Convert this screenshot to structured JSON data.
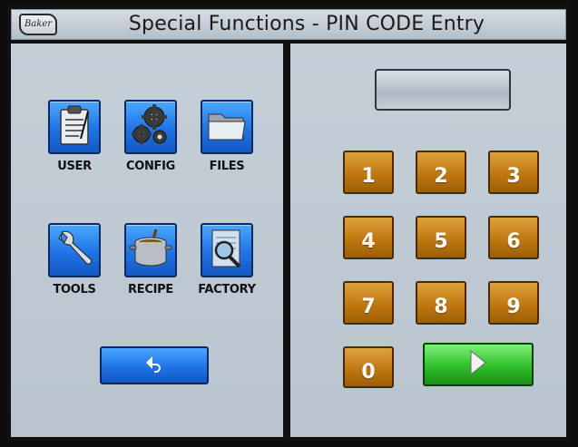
{
  "window": {
    "title": "Special Functions - PIN CODE Entry",
    "logo_text": "Baker"
  },
  "menu": {
    "items": [
      {
        "label": "USER",
        "icon": "clipboard-icon"
      },
      {
        "label": "CONFIG",
        "icon": "gears-icon"
      },
      {
        "label": "FILES",
        "icon": "folder-icon"
      },
      {
        "label": "TOOLS",
        "icon": "wrench-icon"
      },
      {
        "label": "RECIPE",
        "icon": "pot-icon"
      },
      {
        "label": "FACTORY",
        "icon": "magnifier-icon"
      }
    ],
    "back_icon": "back-arrow-icon"
  },
  "pin": {
    "display_value": ""
  },
  "keypad": {
    "keys": [
      "1",
      "2",
      "3",
      "4",
      "5",
      "6",
      "7",
      "8",
      "9",
      "0"
    ],
    "enter_icon": "play-arrow-icon"
  },
  "colors": {
    "menu_button": "#1f73e6",
    "key_button": "#c0780f",
    "enter_button": "#2fbf2a",
    "panel": "#c0cad4"
  }
}
